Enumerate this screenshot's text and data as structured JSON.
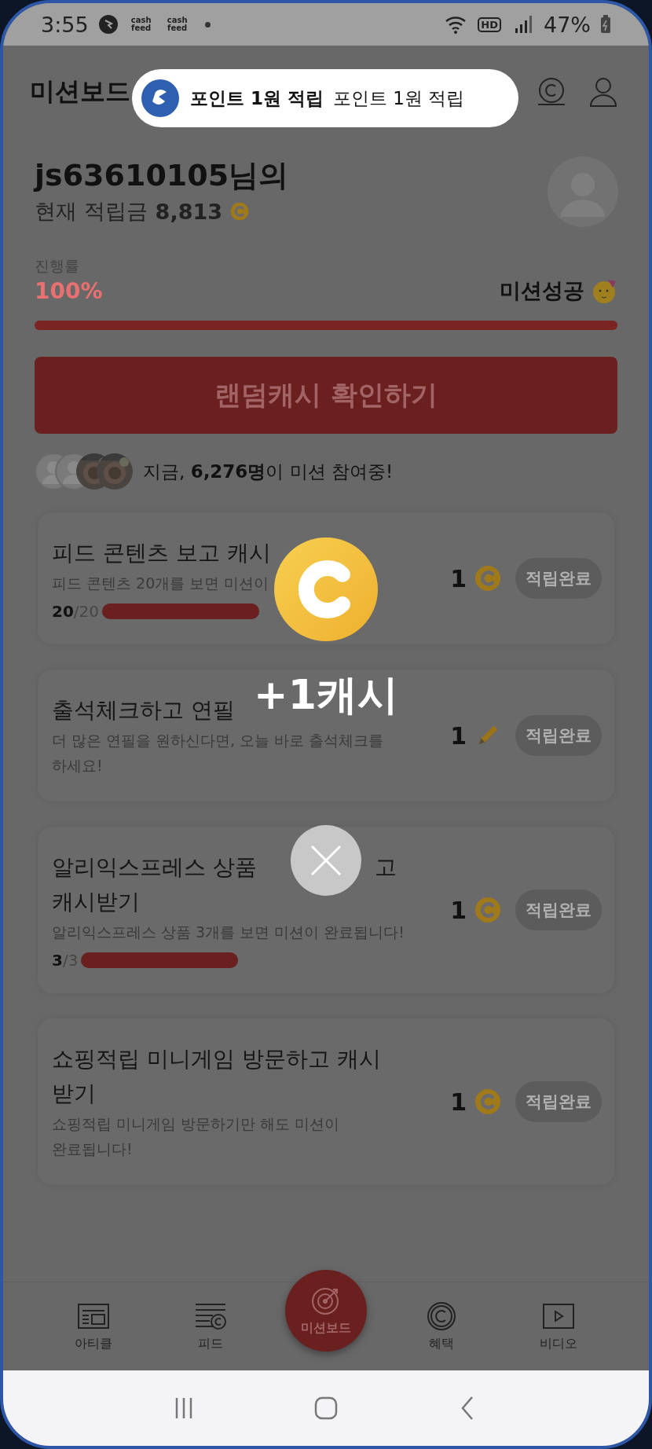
{
  "status_bar": {
    "time": "3:55",
    "notifications": [
      {
        "text": "cash feed"
      },
      {
        "text": "cash feed"
      }
    ],
    "hd_badge": "HD",
    "battery": "47%"
  },
  "header": {
    "title": "미션보드"
  },
  "toast": {
    "title": "포인트 1원 적립",
    "message": "포인트 1원 적립"
  },
  "profile": {
    "greeting": "js63610105님의",
    "balance_label": "현재 적립금",
    "balance": "8,813"
  },
  "progress": {
    "label": "진행률",
    "percent": "100%",
    "status": "미션성공",
    "level": 1
  },
  "cta": {
    "label": "랜덤캐시 확인하기"
  },
  "participants": {
    "avatars": [
      {
        "kind": "default"
      },
      {
        "kind": "default"
      },
      {
        "kind": "picture"
      },
      {
        "kind": "picture"
      }
    ],
    "text": "지금, **6,276명**이 미션 참여중!"
  },
  "missions": [
    {
      "kind": "coin",
      "title_lines": [
        [
          "피드 콘텐츠 보고 캐시"
        ]
      ],
      "description_lines": [
        "피드 콘텐츠 20개를 보면 미션이"
      ],
      "progress": {
        "done": "20",
        "total": "/20",
        "level": 1
      },
      "reward": "1",
      "button": "적립완료"
    },
    {
      "kind": "pencil",
      "title_lines": [
        [
          "출석체크하고 연필"
        ]
      ],
      "description_lines": [
        "더 많은 연필을 원하신다면, 오늘 바로 출석체크를",
        "하세요!"
      ],
      "reward": "1",
      "button": "적립완료"
    },
    {
      "kind": "coin",
      "title_lines": [
        [
          "알리익스프레스 상품",
          "고"
        ],
        [
          "캐시받기"
        ]
      ],
      "description_lines": [
        "알리익스프레스 상품 3개를 보면 미션이 완료됩니다!"
      ],
      "progress": {
        "done": "3",
        "total": "/3",
        "level": 1
      },
      "reward": "1",
      "button": "적립완료"
    },
    {
      "kind": "coin",
      "title_lines": [
        [
          "쇼핑적립 미니게임 방문하고 캐시"
        ],
        [
          "받기"
        ]
      ],
      "description_lines": [
        "쇼핑적립 미니게임 방문하기만 해도 미션이",
        "완료됩니다!"
      ],
      "reward": "1",
      "button": "적립완료"
    }
  ],
  "reward_popup": {
    "amount": "+1캐시"
  },
  "bottom_nav": [
    {
      "label": "아티클",
      "selected": false
    },
    {
      "label": "피드",
      "selected": false
    },
    {
      "label": "미션보드",
      "selected": true
    },
    {
      "label": "혜택",
      "selected": false
    },
    {
      "label": "비디오",
      "selected": false
    }
  ]
}
